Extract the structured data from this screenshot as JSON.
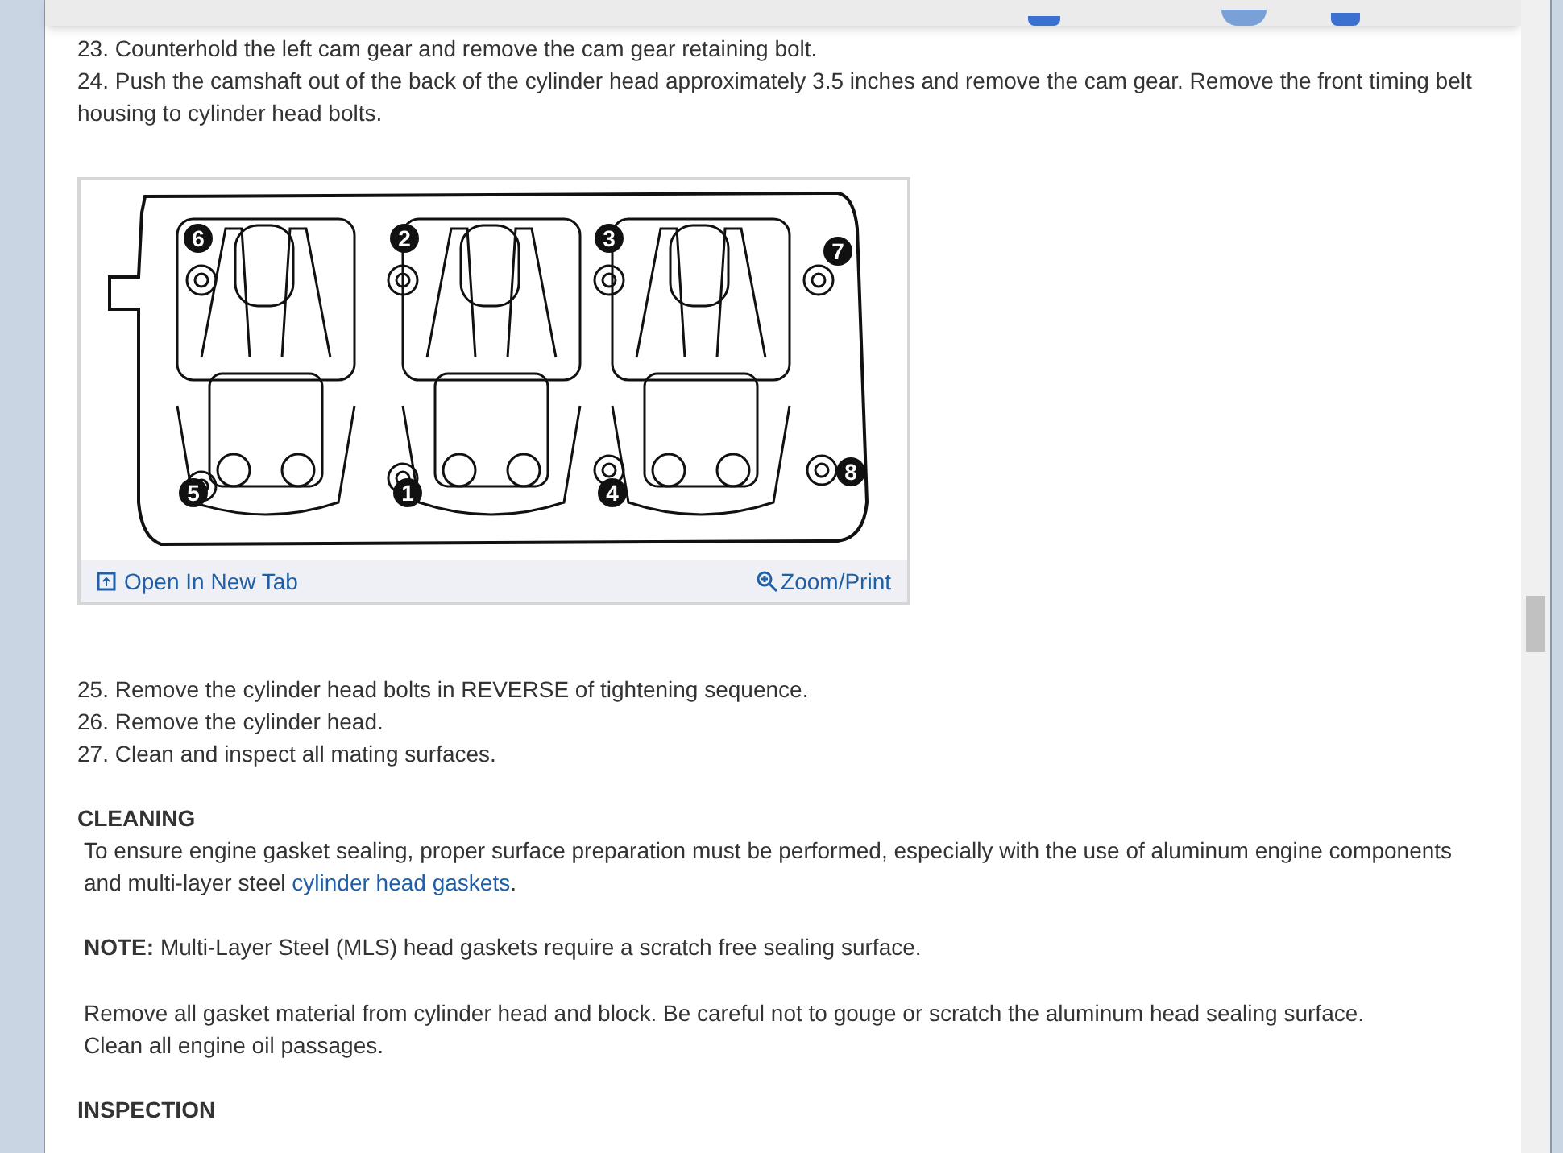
{
  "steps_top": [
    "23. Counterhold the left cam gear and remove the cam gear retaining bolt.",
    "24. Push the camshaft out of the back of the cylinder head approximately 3.5 inches and remove the cam gear. Remove the front timing belt housing to cylinder head bolts."
  ],
  "figure": {
    "callouts": [
      "6",
      "2",
      "3",
      "7",
      "5",
      "1",
      "4",
      "8"
    ],
    "open_link": "Open In New Tab",
    "zoom_link": "Zoom/Print"
  },
  "steps_bottom": [
    "25. Remove the cylinder head bolts in REVERSE of tightening sequence.",
    "26. Remove the cylinder head.",
    "27. Clean and inspect all mating surfaces."
  ],
  "cleaning": {
    "heading": "CLEANING",
    "text_before": "To ensure engine gasket sealing, proper surface preparation must be performed, especially with the use of aluminum engine components and multi-layer steel ",
    "link": "cylinder head gaskets",
    "text_after": ".",
    "note": "**NOTE:** Multi-Layer Steel (MLS) head gaskets require a scratch free sealing surface.",
    "lines": [
      "Remove all gasket material from cylinder head and block. Be careful not to gouge or scratch the aluminum head sealing surface.",
      "Clean all engine oil passages."
    ]
  },
  "inspection": {
    "heading": "INSPECTION"
  }
}
